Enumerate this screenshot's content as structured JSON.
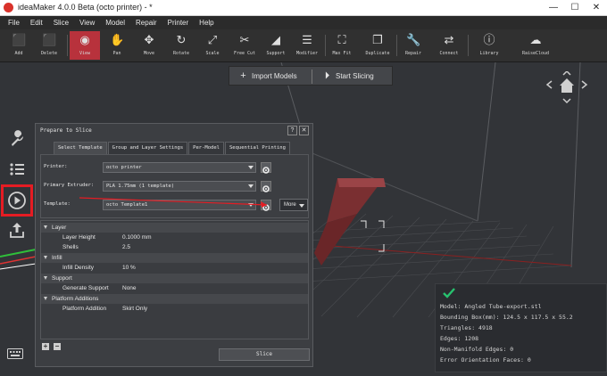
{
  "window": {
    "title": "ideaMaker 4.0.0 Beta (octo printer) - *",
    "buttons": [
      "—",
      "☐",
      "✕"
    ]
  },
  "menu": [
    "File",
    "Edit",
    "Slice",
    "View",
    "Model",
    "Repair",
    "Printer",
    "Help"
  ],
  "toolbar": [
    {
      "label": "Add",
      "icon": "add-cube-icon",
      "active": false
    },
    {
      "label": "Delete",
      "icon": "delete-cube-icon",
      "active": false
    },
    {
      "label": "View",
      "icon": "eye-icon",
      "active": true
    },
    {
      "label": "Pan",
      "icon": "hand-icon",
      "active": false
    },
    {
      "label": "Move",
      "icon": "move-arrows-icon",
      "active": false
    },
    {
      "label": "Rotate",
      "icon": "rotate-icon",
      "active": false
    },
    {
      "label": "Scale",
      "icon": "scale-icon",
      "active": false
    },
    {
      "label": "Free Cut",
      "icon": "scissors-icon",
      "active": false
    },
    {
      "label": "Support",
      "icon": "support-icon",
      "active": false
    },
    {
      "label": "Modifier",
      "icon": "sliders-icon",
      "active": false
    },
    {
      "label": "Max Fit",
      "icon": "max-fit-icon",
      "active": false
    },
    {
      "label": "Duplicate",
      "icon": "duplicate-icon",
      "active": false
    },
    {
      "label": "Repair",
      "icon": "wrench-icon",
      "active": false
    },
    {
      "label": "Connect",
      "icon": "connect-icon",
      "active": false
    },
    {
      "label": "Library",
      "icon": "library-icon",
      "active": false
    },
    {
      "label": "RaiseCloud",
      "icon": "cloud-icon",
      "active": false
    }
  ],
  "actions": {
    "import": "Import Models",
    "slice": "Start Slicing"
  },
  "sidebar": [
    {
      "icon": "wrench-icon",
      "highlight": false
    },
    {
      "icon": "list-icon",
      "highlight": false
    },
    {
      "icon": "play-circle-icon",
      "highlight": true
    },
    {
      "icon": "upload-icon",
      "highlight": false
    }
  ],
  "dialog": {
    "title": "Prepare to Slice",
    "buttons": [
      "?",
      "✕"
    ],
    "tabs": [
      "Select Template",
      "Group and Layer Settings",
      "Per-Model",
      "Sequential Printing"
    ],
    "active_tab": 0,
    "rows": [
      {
        "label": "Printer:",
        "value": "octo printer"
      },
      {
        "label": "Primary Extruder:",
        "value": "PLA 1.75mm (1 template)"
      },
      {
        "label": "Template:",
        "value": "octo Template1"
      }
    ],
    "more_label": "More",
    "tree": [
      {
        "name": "Layer",
        "children": [
          {
            "k": "Layer Height",
            "v": "0.1000 mm"
          },
          {
            "k": "Shells",
            "v": "2.5"
          }
        ]
      },
      {
        "name": "Infill",
        "children": [
          {
            "k": "Infill Density",
            "v": "10 %"
          }
        ]
      },
      {
        "name": "Support",
        "children": [
          {
            "k": "Generate Support",
            "v": "None"
          }
        ]
      },
      {
        "name": "Platform Additions",
        "children": [
          {
            "k": "Platform Addition",
            "v": "Skirt Only"
          }
        ]
      }
    ],
    "slice_button": "Slice",
    "add": "+",
    "remove": "−"
  },
  "model_info": [
    "Model: Angled Tube-export.stl",
    "Bounding Box(mm): 124.5 x 117.5 x 55.2",
    "Triangles: 4918",
    "Edges: 1208",
    "Non-Manifold Edges: 0",
    "Error Orientation Faces: 0"
  ],
  "colors": {
    "accent": "#b8323c",
    "highlight_border": "#e51c23",
    "check": "#27c26f"
  }
}
